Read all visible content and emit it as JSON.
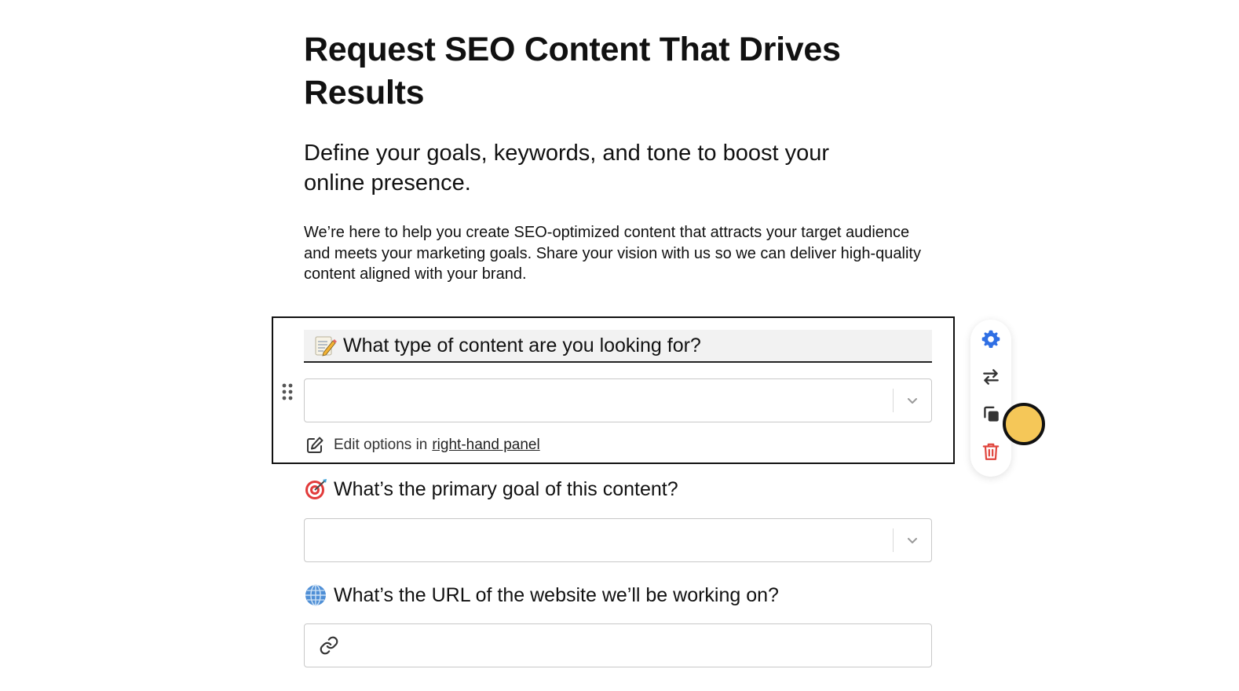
{
  "page": {
    "title": "Request SEO Content That Drives Results",
    "subtitle": "Define your goals, keywords, and tone to boost your online presence.",
    "description": "We’re here to help you create SEO-optimized content that attracts your target audience and meets your marketing goals. Share your vision with us so we can deliver high-quality content aligned with your brand."
  },
  "questions": [
    {
      "emoji": "memo-icon",
      "label": "What type of content are you looking for?",
      "type": "dropdown",
      "value": ""
    },
    {
      "emoji": "target-icon",
      "label": "What’s the primary goal of this content?",
      "type": "dropdown",
      "value": ""
    },
    {
      "emoji": "globe-icon",
      "label": "What’s the URL of the website we’ll be working on?",
      "type": "url",
      "value": ""
    }
  ],
  "edit_hint": {
    "prefix": "Edit options in",
    "link": "right-hand panel"
  },
  "toolbar": {
    "items": [
      "gear-icon",
      "swap-icon",
      "duplicate-icon",
      "trash-icon"
    ]
  },
  "colors": {
    "accent_blue": "#2f6fe4",
    "delete_red": "#e0443c",
    "cursor_yellow": "#f5c758",
    "label_bg": "#f2f2f2"
  }
}
